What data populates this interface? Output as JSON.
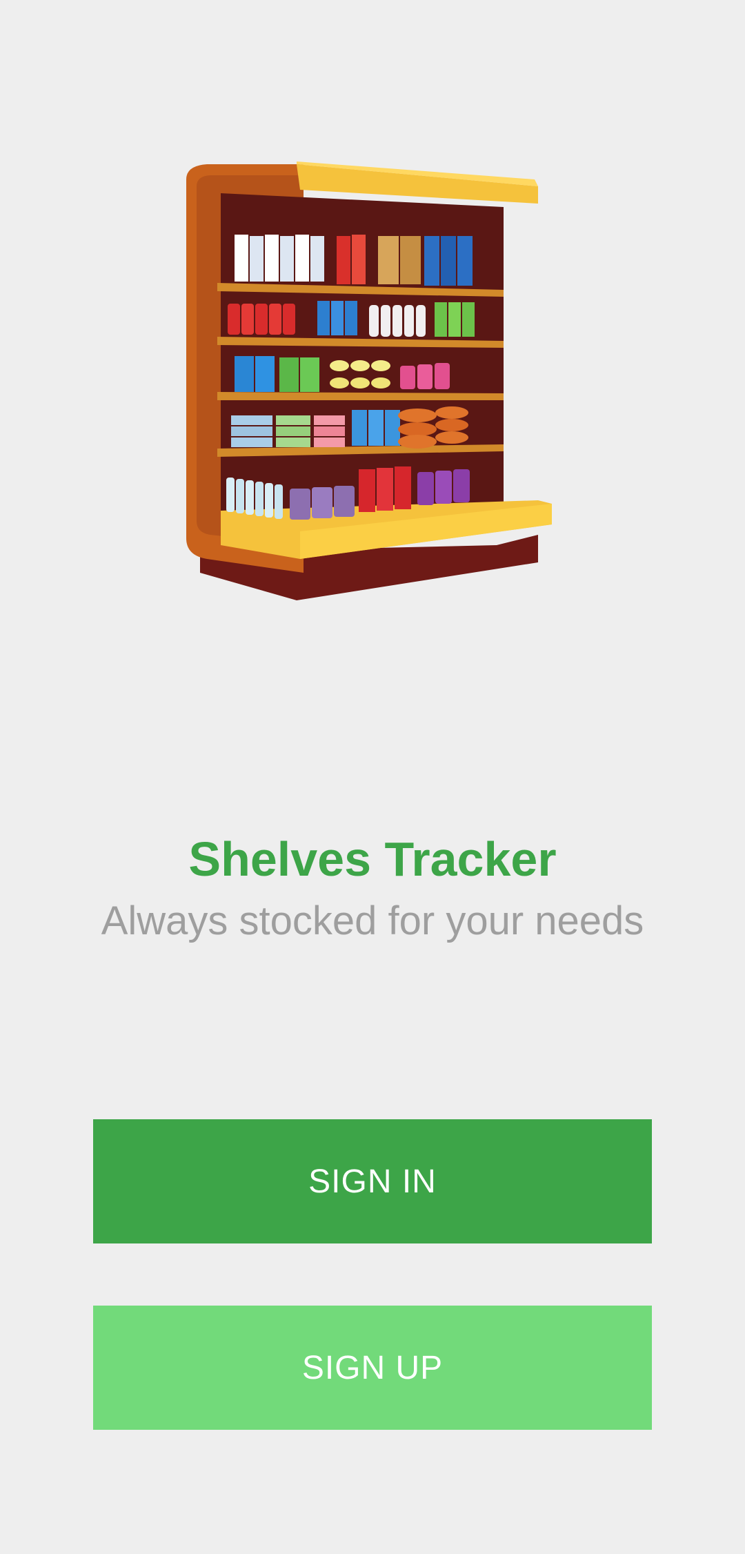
{
  "app": {
    "title": "Shelves Tracker",
    "tagline": "Always stocked for your needs",
    "hero_image": "store-shelf-illustration"
  },
  "actions": {
    "sign_in_label": "SIGN IN",
    "sign_up_label": "SIGN UP"
  },
  "colors": {
    "background": "#eeeeee",
    "title": "#3da548",
    "tagline": "#9e9e9e",
    "sign_in_button": "#3da548",
    "sign_up_button": "#72da7a",
    "button_text": "#ffffff"
  }
}
